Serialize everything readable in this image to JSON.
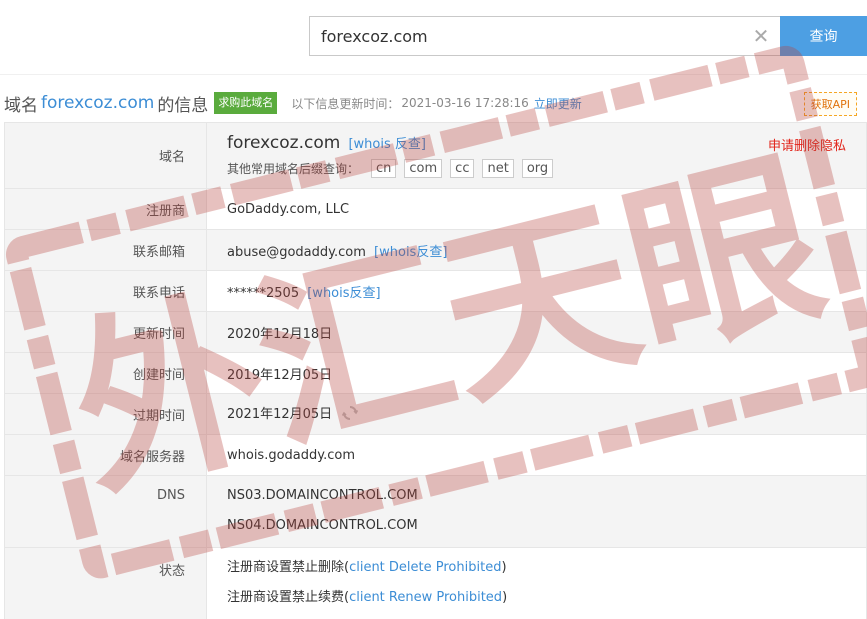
{
  "search": {
    "value": "forexcoz.com",
    "clear_icon": "close-icon",
    "button_label": "查询"
  },
  "header": {
    "title_prefix": "域名",
    "domain": "forexcoz.com",
    "title_suffix": "的信息",
    "buy_badge": "求购此域名",
    "update_label": "以下信息更新时间：",
    "update_time": "2021-03-16 17:28:16",
    "update_now": "立即更新",
    "api_button": "获取API"
  },
  "table": {
    "domain": {
      "label": "域名",
      "value": "forexcoz.com",
      "whois_link": "[whois 反查]",
      "privacy_link": "申请删除隐私",
      "suffix_label": "其他常用域名后缀查询：",
      "suffixes": [
        "cn",
        "com",
        "cc",
        "net",
        "org"
      ]
    },
    "registrar": {
      "label": "注册商",
      "value": "GoDaddy.com, LLC"
    },
    "email": {
      "label": "联系邮箱",
      "value": "abuse@godaddy.com",
      "whois_link": "[whois反查]"
    },
    "phone": {
      "label": "联系电话",
      "value": "******2505",
      "whois_link": "[whois反查]"
    },
    "updated": {
      "label": "更新时间",
      "value": "2020年12月18日"
    },
    "created": {
      "label": "创建时间",
      "value": "2019年12月05日"
    },
    "expires": {
      "label": "过期时间",
      "value": "2021年12月05日",
      "icon": "refresh-icon"
    },
    "whois_server": {
      "label": "域名服务器",
      "value": "whois.godaddy.com"
    },
    "dns": {
      "label": "DNS",
      "values": [
        "NS03.DOMAINCONTROL.COM",
        "NS04.DOMAINCONTROL.COM"
      ]
    },
    "status": {
      "label": "状态",
      "items": [
        {
          "text": "注册商设置禁止删除(",
          "code": "client Delete Prohibited",
          "close": ")"
        },
        {
          "text": "注册商设置禁止续费(",
          "code": "client Renew Prohibited",
          "close": ")"
        }
      ]
    }
  },
  "watermark": {
    "text": "外汇天眼",
    "color": "#c0504d"
  }
}
